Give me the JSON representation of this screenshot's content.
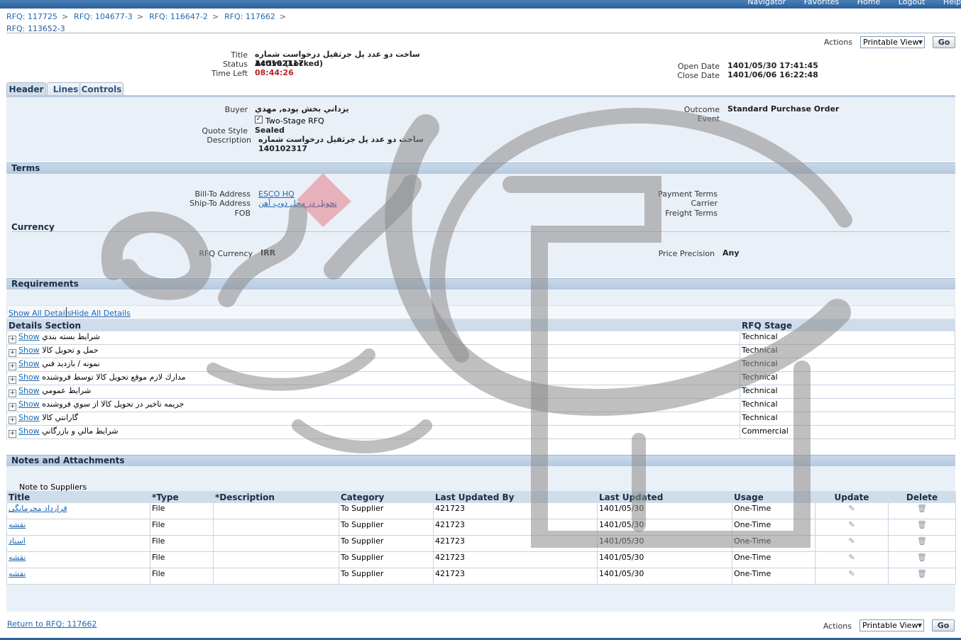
{
  "top_nav": [
    "Navigator",
    "Favorites",
    "Home",
    "Logout",
    "Help"
  ],
  "breadcrumbs": [
    "RFQ: 117725",
    "RFQ: 104677-3",
    "RFQ: 116647-2",
    "RFQ: 117662"
  ],
  "crumb_separator": ">",
  "current_page": "RFQ: 113652-3",
  "actions": {
    "label": "Actions",
    "selected": "Printable View",
    "go": "Go"
  },
  "summary": {
    "title_label": "Title",
    "title_value": "ساخت دو عدد پل جرثقیل درخواست شماره 140102317",
    "status_label": "Status",
    "status_value": "Active (Locked)",
    "time_left_label": "Time Left",
    "time_left_value": "08:44:26",
    "open_date_label": "Open Date",
    "open_date_value": "1401/05/30 17:41:45",
    "close_date_label": "Close Date",
    "close_date_value": "1401/06/06 16:22:48"
  },
  "tabs": [
    "Header",
    "Lines",
    "Controls"
  ],
  "header_panel": {
    "buyer_label": "Buyer",
    "buyer_value": "يزداني بخش پوده, مهدي",
    "two_stage_label": "Two-Stage RFQ",
    "quote_style_label": "Quote Style",
    "quote_style_value": "Sealed",
    "description_label": "Description",
    "description_value": "ساخت دو عدد پل جرثقیل درخواست شماره 140102317",
    "outcome_label": "Outcome",
    "outcome_value": "Standard Purchase Order",
    "event_label": "Event"
  },
  "terms": {
    "heading": "Terms",
    "bill_to_label": "Bill-To Address",
    "bill_to_value": "ESCO HQ",
    "ship_to_label": "Ship-To Address",
    "ship_to_value": "تحویل در محل ذوب آهن",
    "fob_label": "FOB",
    "payment_terms_label": "Payment Terms",
    "carrier_label": "Carrier",
    "freight_terms_label": "Freight Terms",
    "currency_heading": "Currency",
    "rfq_currency_label": "RFQ Currency",
    "rfq_currency_value": "IRR",
    "price_precision_label": "Price Precision",
    "price_precision_value": "Any"
  },
  "requirements": {
    "heading": "Requirements",
    "show_all": "Show All Details",
    "hide_all": "Hide All Details",
    "columns": [
      "Details Section",
      "RFQ Stage"
    ],
    "show_label": "Show",
    "rows": [
      {
        "section": "شرايط بسته بندي",
        "stage": "Technical"
      },
      {
        "section": "حمل و تحويل كالا",
        "stage": "Technical"
      },
      {
        "section": "نمونه / بازديد فني",
        "stage": "Technical"
      },
      {
        "section": "مدارك لازم موقع تحويل كالا توسط فروشنده",
        "stage": "Technical"
      },
      {
        "section": "شرايط عمومي",
        "stage": "Technical"
      },
      {
        "section": "جريمه تاخير در تحويل كالا از سوي فروشنده",
        "stage": "Technical"
      },
      {
        "section": "گارانتي كالا",
        "stage": "Technical"
      },
      {
        "section": "شرايط مالي و بازرگاني",
        "stage": "Commercial"
      }
    ]
  },
  "notes": {
    "heading": "Notes and Attachments",
    "note_label": "Note to Suppliers",
    "columns": [
      "Title",
      "*Type",
      "*Description",
      "Category",
      "Last Updated By",
      "Last Updated",
      "Usage",
      "Update",
      "Delete"
    ],
    "rows": [
      {
        "title": "قرارداد محرمانگی",
        "type": "File",
        "description": "",
        "category": "To Supplier",
        "by": "421723",
        "date": "1401/05/30",
        "usage": "One-Time"
      },
      {
        "title": "نقشه",
        "type": "File",
        "description": "",
        "category": "To Supplier",
        "by": "421723",
        "date": "1401/05/30",
        "usage": "One-Time"
      },
      {
        "title": "اسناد",
        "type": "File",
        "description": "",
        "category": "To Supplier",
        "by": "421723",
        "date": "1401/05/30",
        "usage": "One-Time"
      },
      {
        "title": "نقشه",
        "type": "File",
        "description": "",
        "category": "To Supplier",
        "by": "421723",
        "date": "1401/05/30",
        "usage": "One-Time"
      },
      {
        "title": "نقشه",
        "type": "File",
        "description": "",
        "category": "To Supplier",
        "by": "421723",
        "date": "1401/05/30",
        "usage": "One-Time"
      }
    ]
  },
  "return_link": "Return to RFQ: 117662",
  "watermark_text": [
    "اهراره",
    "ارتباط گستران"
  ]
}
